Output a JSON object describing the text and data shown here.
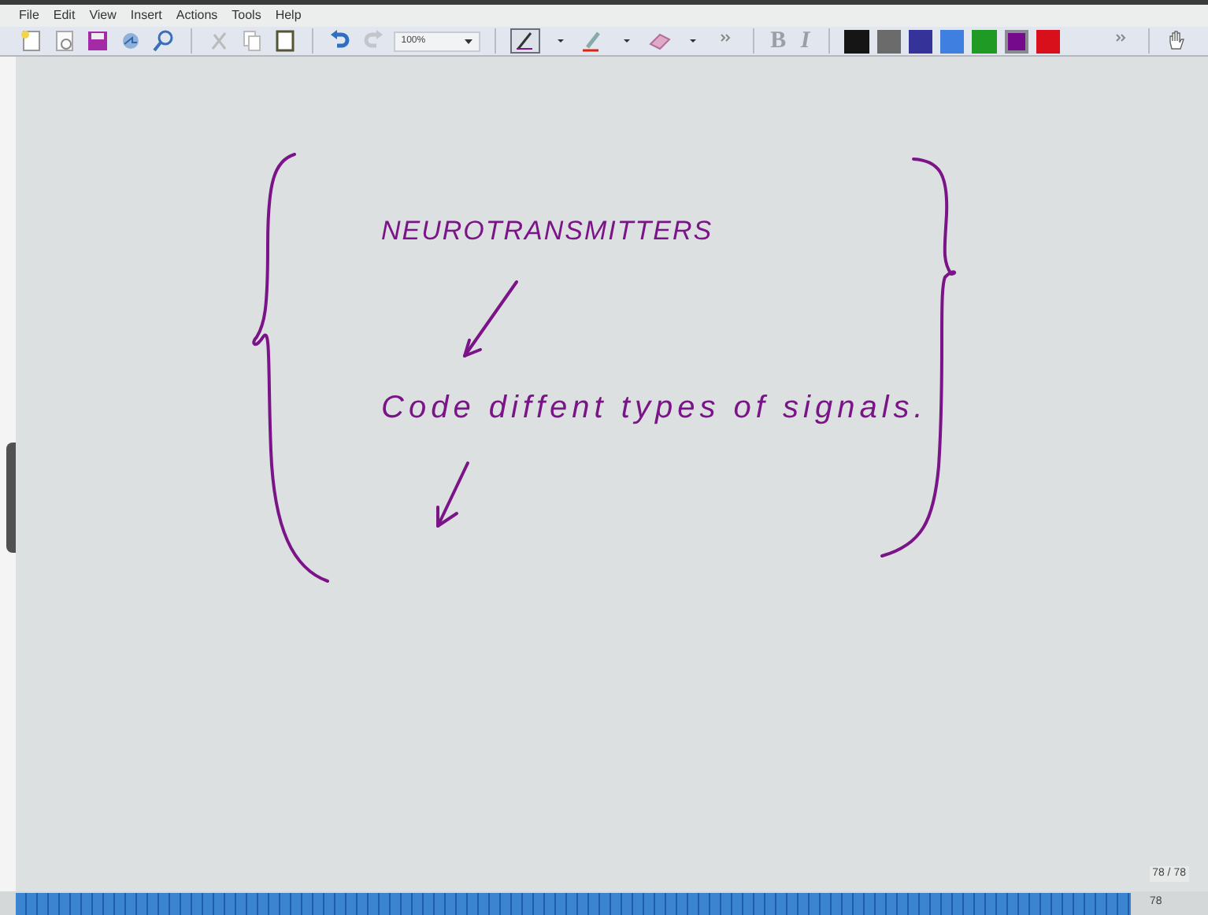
{
  "menu": [
    "File",
    "Edit",
    "View",
    "Insert",
    "Actions",
    "Tools",
    "Help"
  ],
  "toolbar": {
    "zoom": "100%",
    "format_buttons": [
      {
        "label": "B",
        "disabled": true
      },
      {
        "label": "I",
        "disabled": true
      }
    ],
    "swatches": [
      {
        "color": "#151515",
        "selected": false
      },
      {
        "color": "#6b6b6b",
        "selected": false
      },
      {
        "color": "#35339a",
        "selected": false
      },
      {
        "color": "#3f7fe0",
        "selected": false
      },
      {
        "color": "#1f9a25",
        "selected": false
      },
      {
        "color": "#750a8c",
        "selected": true
      },
      {
        "color": "#d8101c",
        "selected": false
      }
    ]
  },
  "page": {
    "notes": [
      {
        "text": "NEUROTRANSMITTERS"
      },
      {
        "text": "Code diffent types of signals."
      }
    ]
  },
  "status": {
    "page_counter": "78 / 78",
    "page_number": "78"
  }
}
